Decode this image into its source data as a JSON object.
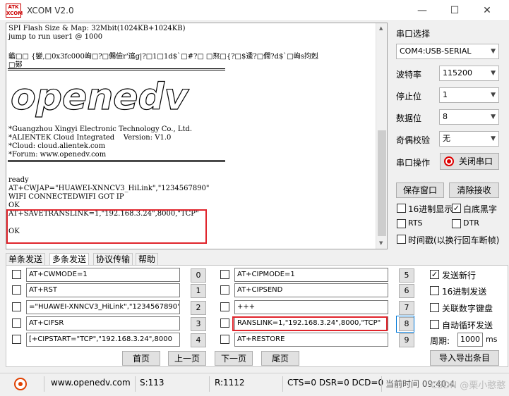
{
  "window": {
    "logo": "ATK XCOM",
    "title": "XCOM V2.0",
    "minimize": "—",
    "maximize": "☐",
    "close": "✕"
  },
  "terminal": {
    "lines": [
      "SPI Flash Size & Map: 32Mbit(1024KB+1024KB)",
      "jump to run user1 @ 1000",
      "",
      "龤□□ {孌,□0x3fc000峋□?□儩儉r'逭g|?□1□1d$`□#?□ □焣□{?□$逶?□僴?d$`□峋s抣剋",
      "□鄚",
      "",
      "",
      "",
      "",
      "",
      "",
      "",
      "*Guangzhou Xingyi Electronic Technology Co., Ltd.",
      "*ALIENTEK Cloud Integrated    Version: V1.0",
      "*Cloud: cloud.alientek.com",
      "*Forum: www.openedv.com",
      "",
      "",
      "ready",
      "AT+CWJAP=\"HUAWEI-XNNCV3_HiLink\",\"1234567890\"",
      "WIFI CONNECTEDWIFI GOT IP",
      "OK",
      "AT+SAVETRANSLINK=1,\"192.168.3.24\",8000,\"TCP\"",
      "",
      "OK"
    ],
    "banner": "openedv"
  },
  "settings": {
    "port_select_label": "串口选择",
    "port_value": "COM4:USB-SERIAL",
    "baud_label": "波特率",
    "baud_value": "115200",
    "stop_label": "停止位",
    "stop_value": "1",
    "data_label": "数据位",
    "data_value": "8",
    "parity_label": "奇偶校验",
    "parity_value": "无",
    "op_label": "串口操作",
    "close_port": "关闭串口",
    "save_window": "保存窗口",
    "clear_recv": "清除接收",
    "hex_display": "16进制显示",
    "white_bg": "白底黑字",
    "rts": "RTS",
    "dtr": "DTR",
    "timestamp": "时间戳(以换行回车断帧)"
  },
  "tabs": [
    "单条发送",
    "多条发送",
    "协议传输",
    "帮助"
  ],
  "multi_send": {
    "left": [
      {
        "text": "AT+CWMODE=1",
        "num": "0"
      },
      {
        "text": "AT+RST",
        "num": "1"
      },
      {
        "text": "=\"HUAWEI-XNNCV3_HiLink\",\"1234567890\"",
        "num": "2"
      },
      {
        "text": "AT+CIFSR",
        "num": "3"
      },
      {
        "text": "[+CIPSTART=\"TCP\",\"192.168.3.24\",8000",
        "num": "4"
      }
    ],
    "right": [
      {
        "text": "AT+CIPMODE=1",
        "num": "5"
      },
      {
        "text": "AT+CIPSEND",
        "num": "6"
      },
      {
        "text": "+++",
        "num": "7"
      },
      {
        "text": "RANSLINK=1,\"192.168.3.24\",8000,\"TCP\"",
        "num": "8"
      },
      {
        "text": "AT+RESTORE",
        "num": "9"
      }
    ],
    "send_newline": "发送新行",
    "hex_send": "16进制发送",
    "link_keyboard": "关联数字键盘",
    "auto_loop": "自动循环发送",
    "period_label": "周期:",
    "period_value": "1000",
    "period_unit": "ms",
    "import_export": "导入导出条目",
    "first_page": "首页",
    "prev_page": "上一页",
    "next_page": "下一页",
    "last_page": "尾页"
  },
  "status": {
    "url": "www.openedv.com",
    "sent": "S:113",
    "received": "R:1112",
    "signals": "CTS=0 DSR=0 DCD=0",
    "time": "当前时间 09:40:4",
    "watermark": "CSDN @栗小憨憨"
  }
}
